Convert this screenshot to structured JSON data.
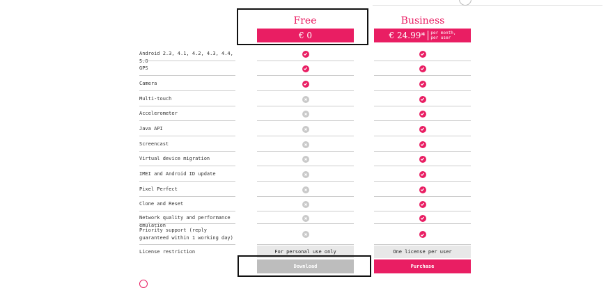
{
  "plans": {
    "free": {
      "name": "Free",
      "price": "€ 0",
      "button": "Download",
      "license": "For personal use only"
    },
    "business": {
      "name": "Business",
      "price": "€ 24.99*",
      "price_unit_1": "per month,",
      "price_unit_2": "per user",
      "button": "Purchase",
      "license": "One license per user"
    }
  },
  "license_label": "License restriction",
  "features": [
    {
      "label": "Android 2.3, 4.1, 4.2, 4.3, 4.4, 5.0",
      "free": true,
      "business": true
    },
    {
      "label": "GPS",
      "free": true,
      "business": true
    },
    {
      "label": "Camera",
      "free": true,
      "business": true
    },
    {
      "label": "Multi-touch",
      "free": false,
      "business": true
    },
    {
      "label": "Accelerometer",
      "free": false,
      "business": true
    },
    {
      "label": "Java API",
      "free": false,
      "business": true
    },
    {
      "label": "Screencast",
      "free": false,
      "business": true
    },
    {
      "label": "Virtual device migration",
      "free": false,
      "business": true
    },
    {
      "label": "IMEI and Android ID update",
      "free": false,
      "business": true
    },
    {
      "label": "Pixel Perfect",
      "free": false,
      "business": true
    },
    {
      "label": "Clone and Reset",
      "free": false,
      "business": true
    },
    {
      "label": "Network quality and performance emulation",
      "free": false,
      "business": true
    },
    {
      "label": "Priority support (reply guaranteed within 1 working day)",
      "free": false,
      "business": true
    }
  ],
  "colors": {
    "accent": "#e91e63",
    "muted": "#c9c9c9",
    "cell_bg": "#e8e8e8"
  },
  "icons": {
    "included": "check-icon",
    "excluded": "cross-icon"
  }
}
